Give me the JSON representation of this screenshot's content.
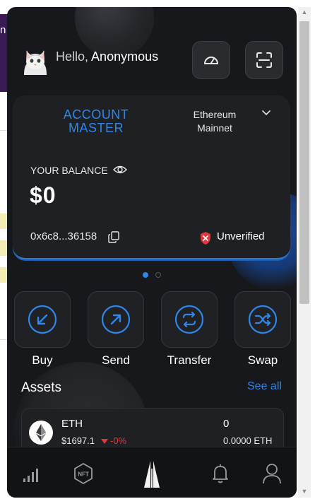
{
  "background": {
    "edge_text": "n"
  },
  "header": {
    "greeting_prefix": "Hello,",
    "username": "Anonymous",
    "avatar_icon": "cat-avatar-icon",
    "speed_icon": "speedometer-icon",
    "scan_icon": "scan-icon"
  },
  "account_card": {
    "account_name_line1": "ACCOUNT",
    "account_name_line2": "MASTER",
    "network_line1": "Ethereum",
    "network_line2": "Mainnet",
    "balance_label": "YOUR BALANCE",
    "balance_value": "$0",
    "address": "0x6c8...36158",
    "verification_status": "Unverified",
    "accent_color": "#2f86e6",
    "status_color": "#e0383e"
  },
  "carousel": {
    "page_count": 2,
    "active_index": 0
  },
  "actions": [
    {
      "label": "Buy",
      "icon": "arrow-down-left-icon"
    },
    {
      "label": "Send",
      "icon": "arrow-up-right-icon"
    },
    {
      "label": "Transfer",
      "icon": "transfer-icon"
    },
    {
      "label": "Swap",
      "icon": "swap-icon"
    }
  ],
  "assets": {
    "title": "Assets",
    "see_all": "See all",
    "items": [
      {
        "symbol": "ETH",
        "price": "$1697.1",
        "change": "-0%",
        "amount": "0",
        "amount_token": "0.0000 ETH"
      }
    ]
  },
  "bottom_nav": [
    {
      "name": "stats",
      "icon": "bar-chart-icon"
    },
    {
      "name": "nft",
      "icon": "nft-icon",
      "label": "NFT"
    },
    {
      "name": "home",
      "icon": "logo-icon"
    },
    {
      "name": "notifications",
      "icon": "bell-icon"
    },
    {
      "name": "profile",
      "icon": "user-icon"
    }
  ]
}
